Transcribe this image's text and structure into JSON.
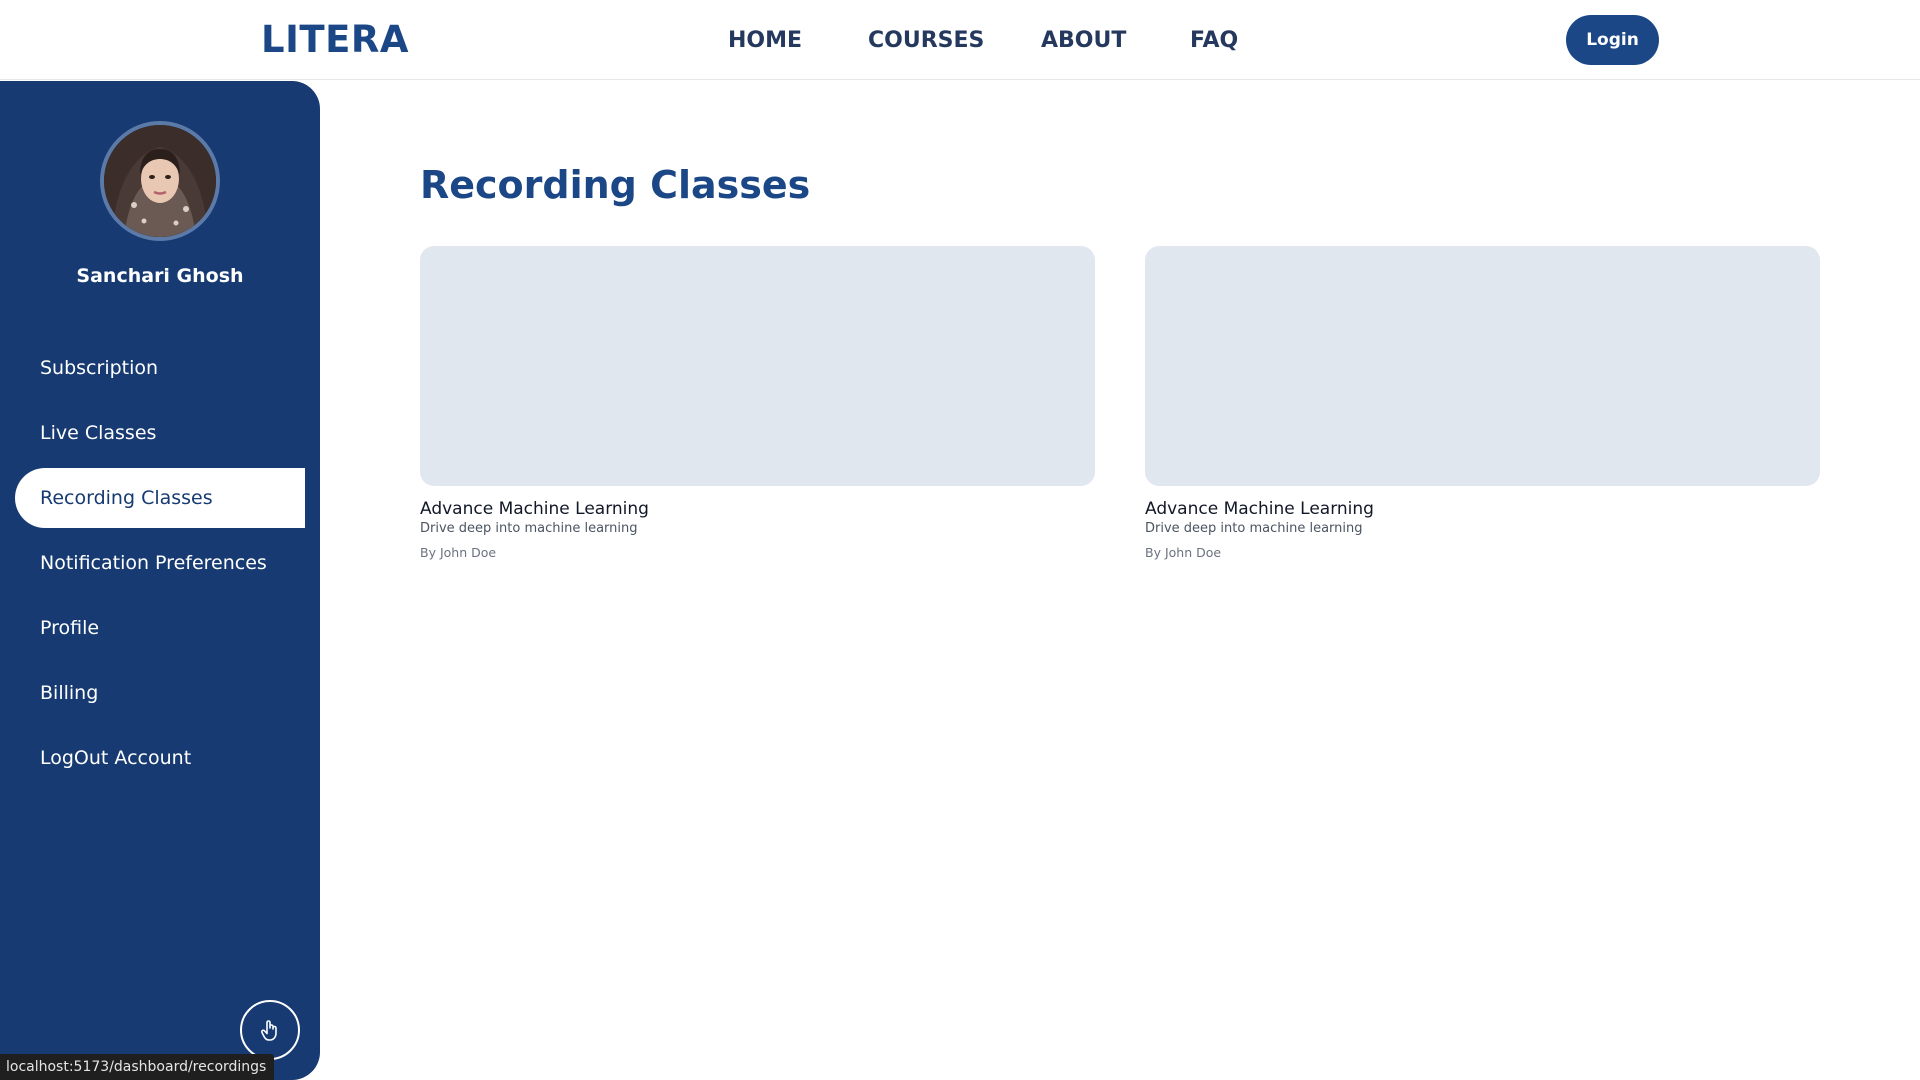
{
  "header": {
    "brand": "LITERA",
    "nav": [
      "HOME",
      "COURSES",
      "ABOUT",
      "FAQ"
    ],
    "login_label": "Login"
  },
  "sidebar": {
    "user_name": "Sanchari Ghosh",
    "items": [
      {
        "label": "Subscription",
        "active": false
      },
      {
        "label": "Live Classes",
        "active": false
      },
      {
        "label": "Recording Classes",
        "active": true
      },
      {
        "label": "Notification Preferences",
        "active": false
      },
      {
        "label": "Profile",
        "active": false
      },
      {
        "label": "Billing",
        "active": false
      },
      {
        "label": "LogOut Account",
        "active": false
      }
    ],
    "floating_button_icon": "hand-pointer-icon"
  },
  "main": {
    "title": "Recording Classes",
    "cards": [
      {
        "title": "Advance Machine Learning",
        "description": "Drive deep into machine learning",
        "author": "By John Doe"
      },
      {
        "title": "Advance Machine Learning",
        "description": "Drive deep into machine learning",
        "author": "By John Doe"
      }
    ]
  },
  "statusbar": {
    "url": "localhost:5173/dashboard/recordings"
  },
  "colors": {
    "brand": "#1b4787",
    "sidebar_bg": "#163a71",
    "thumb_bg": "#e1e7ef"
  }
}
